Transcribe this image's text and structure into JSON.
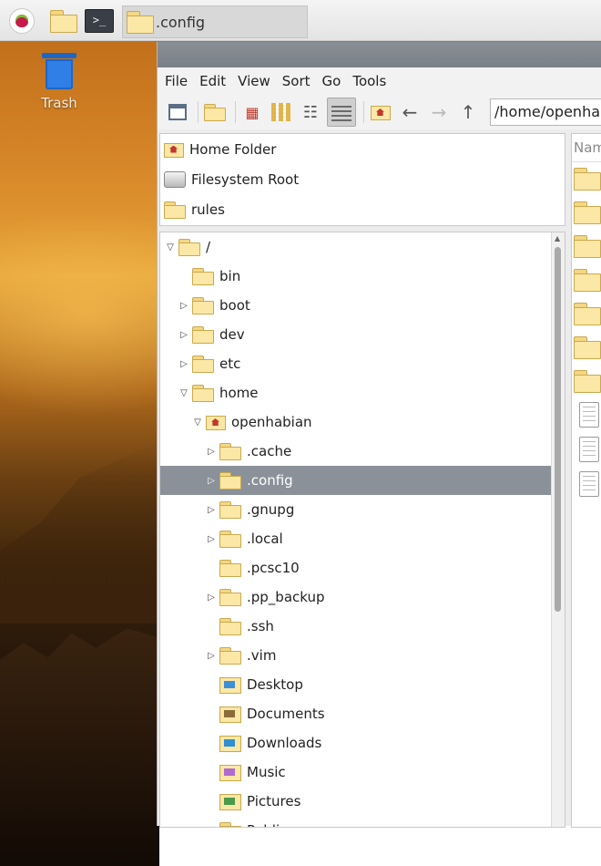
{
  "taskbar": {
    "window_title": ".config"
  },
  "desktop": {
    "trash_label": "Trash"
  },
  "menu": [
    "File",
    "Edit",
    "View",
    "Sort",
    "Go",
    "Tools"
  ],
  "location": {
    "path": "/home/openhabian/.config"
  },
  "places": [
    {
      "label": "Home Folder",
      "icon": "home-folder-icon"
    },
    {
      "label": "Filesystem Root",
      "icon": "drive-icon"
    },
    {
      "label": "rules",
      "icon": "folder-icon"
    }
  ],
  "tree": [
    {
      "label": "/",
      "depth": 0,
      "arrow": "open"
    },
    {
      "label": "bin",
      "depth": 1,
      "arrow": "none"
    },
    {
      "label": "boot",
      "depth": 1,
      "arrow": "closed"
    },
    {
      "label": "dev",
      "depth": 1,
      "arrow": "closed"
    },
    {
      "label": "etc",
      "depth": 1,
      "arrow": "closed"
    },
    {
      "label": "home",
      "depth": 1,
      "arrow": "open"
    },
    {
      "label": "openhabian",
      "depth": 2,
      "arrow": "open",
      "icon": "home"
    },
    {
      "label": ".cache",
      "depth": 3,
      "arrow": "closed"
    },
    {
      "label": ".config",
      "depth": 3,
      "arrow": "closed",
      "selected": true
    },
    {
      "label": ".gnupg",
      "depth": 3,
      "arrow": "closed"
    },
    {
      "label": ".local",
      "depth": 3,
      "arrow": "closed"
    },
    {
      "label": ".pcsc10",
      "depth": 3,
      "arrow": "none"
    },
    {
      "label": ".pp_backup",
      "depth": 3,
      "arrow": "closed"
    },
    {
      "label": ".ssh",
      "depth": 3,
      "arrow": "none"
    },
    {
      "label": ".vim",
      "depth": 3,
      "arrow": "closed"
    },
    {
      "label": "Desktop",
      "depth": 3,
      "arrow": "none",
      "icon": "desktop"
    },
    {
      "label": "Documents",
      "depth": 3,
      "arrow": "none",
      "icon": "documents"
    },
    {
      "label": "Downloads",
      "depth": 3,
      "arrow": "none",
      "icon": "downloads"
    },
    {
      "label": "Music",
      "depth": 3,
      "arrow": "none",
      "icon": "music"
    },
    {
      "label": "Pictures",
      "depth": 3,
      "arrow": "none",
      "icon": "pictures"
    },
    {
      "label": "Public",
      "depth": 3,
      "arrow": "none"
    }
  ],
  "detail": {
    "header": "Name",
    "folder_rows": 7,
    "file_rows": 3
  },
  "colors": {
    "selection": "#8a9199",
    "folder": "#fbe7a6",
    "accent_home": "#c0392b"
  }
}
